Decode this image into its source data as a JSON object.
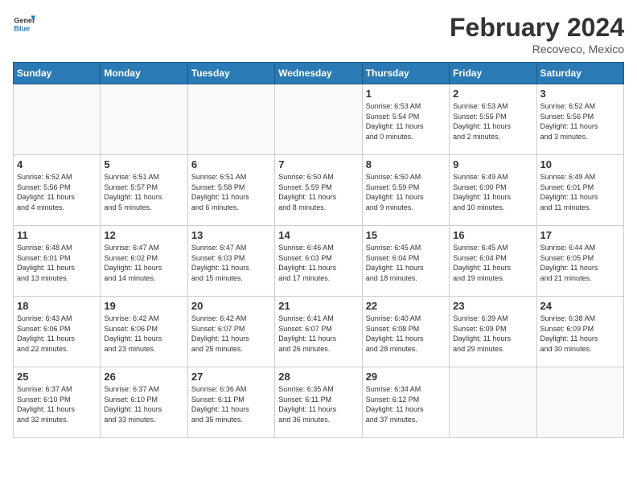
{
  "header": {
    "logo_line1": "General",
    "logo_line2": "Blue",
    "title": "February 2024",
    "subtitle": "Recoveco, Mexico"
  },
  "weekdays": [
    "Sunday",
    "Monday",
    "Tuesday",
    "Wednesday",
    "Thursday",
    "Friday",
    "Saturday"
  ],
  "weeks": [
    [
      {
        "day": "",
        "info": ""
      },
      {
        "day": "",
        "info": ""
      },
      {
        "day": "",
        "info": ""
      },
      {
        "day": "",
        "info": ""
      },
      {
        "day": "1",
        "info": "Sunrise: 6:53 AM\nSunset: 5:54 PM\nDaylight: 11 hours\nand 0 minutes."
      },
      {
        "day": "2",
        "info": "Sunrise: 6:53 AM\nSunset: 5:55 PM\nDaylight: 11 hours\nand 2 minutes."
      },
      {
        "day": "3",
        "info": "Sunrise: 6:52 AM\nSunset: 5:56 PM\nDaylight: 11 hours\nand 3 minutes."
      }
    ],
    [
      {
        "day": "4",
        "info": "Sunrise: 6:52 AM\nSunset: 5:56 PM\nDaylight: 11 hours\nand 4 minutes."
      },
      {
        "day": "5",
        "info": "Sunrise: 6:51 AM\nSunset: 5:57 PM\nDaylight: 11 hours\nand 5 minutes."
      },
      {
        "day": "6",
        "info": "Sunrise: 6:51 AM\nSunset: 5:58 PM\nDaylight: 11 hours\nand 6 minutes."
      },
      {
        "day": "7",
        "info": "Sunrise: 6:50 AM\nSunset: 5:59 PM\nDaylight: 11 hours\nand 8 minutes."
      },
      {
        "day": "8",
        "info": "Sunrise: 6:50 AM\nSunset: 5:59 PM\nDaylight: 11 hours\nand 9 minutes."
      },
      {
        "day": "9",
        "info": "Sunrise: 6:49 AM\nSunset: 6:00 PM\nDaylight: 11 hours\nand 10 minutes."
      },
      {
        "day": "10",
        "info": "Sunrise: 6:49 AM\nSunset: 6:01 PM\nDaylight: 11 hours\nand 11 minutes."
      }
    ],
    [
      {
        "day": "11",
        "info": "Sunrise: 6:48 AM\nSunset: 6:01 PM\nDaylight: 11 hours\nand 13 minutes."
      },
      {
        "day": "12",
        "info": "Sunrise: 6:47 AM\nSunset: 6:02 PM\nDaylight: 11 hours\nand 14 minutes."
      },
      {
        "day": "13",
        "info": "Sunrise: 6:47 AM\nSunset: 6:03 PM\nDaylight: 11 hours\nand 15 minutes."
      },
      {
        "day": "14",
        "info": "Sunrise: 6:46 AM\nSunset: 6:03 PM\nDaylight: 11 hours\nand 17 minutes."
      },
      {
        "day": "15",
        "info": "Sunrise: 6:45 AM\nSunset: 6:04 PM\nDaylight: 11 hours\nand 18 minutes."
      },
      {
        "day": "16",
        "info": "Sunrise: 6:45 AM\nSunset: 6:04 PM\nDaylight: 11 hours\nand 19 minutes."
      },
      {
        "day": "17",
        "info": "Sunrise: 6:44 AM\nSunset: 6:05 PM\nDaylight: 11 hours\nand 21 minutes."
      }
    ],
    [
      {
        "day": "18",
        "info": "Sunrise: 6:43 AM\nSunset: 6:06 PM\nDaylight: 11 hours\nand 22 minutes."
      },
      {
        "day": "19",
        "info": "Sunrise: 6:42 AM\nSunset: 6:06 PM\nDaylight: 11 hours\nand 23 minutes."
      },
      {
        "day": "20",
        "info": "Sunrise: 6:42 AM\nSunset: 6:07 PM\nDaylight: 11 hours\nand 25 minutes."
      },
      {
        "day": "21",
        "info": "Sunrise: 6:41 AM\nSunset: 6:07 PM\nDaylight: 11 hours\nand 26 minutes."
      },
      {
        "day": "22",
        "info": "Sunrise: 6:40 AM\nSunset: 6:08 PM\nDaylight: 11 hours\nand 28 minutes."
      },
      {
        "day": "23",
        "info": "Sunrise: 6:39 AM\nSunset: 6:09 PM\nDaylight: 11 hours\nand 29 minutes."
      },
      {
        "day": "24",
        "info": "Sunrise: 6:38 AM\nSunset: 6:09 PM\nDaylight: 11 hours\nand 30 minutes."
      }
    ],
    [
      {
        "day": "25",
        "info": "Sunrise: 6:37 AM\nSunset: 6:10 PM\nDaylight: 11 hours\nand 32 minutes."
      },
      {
        "day": "26",
        "info": "Sunrise: 6:37 AM\nSunset: 6:10 PM\nDaylight: 11 hours\nand 33 minutes."
      },
      {
        "day": "27",
        "info": "Sunrise: 6:36 AM\nSunset: 6:11 PM\nDaylight: 11 hours\nand 35 minutes."
      },
      {
        "day": "28",
        "info": "Sunrise: 6:35 AM\nSunset: 6:11 PM\nDaylight: 11 hours\nand 36 minutes."
      },
      {
        "day": "29",
        "info": "Sunrise: 6:34 AM\nSunset: 6:12 PM\nDaylight: 11 hours\nand 37 minutes."
      },
      {
        "day": "",
        "info": ""
      },
      {
        "day": "",
        "info": ""
      }
    ]
  ]
}
